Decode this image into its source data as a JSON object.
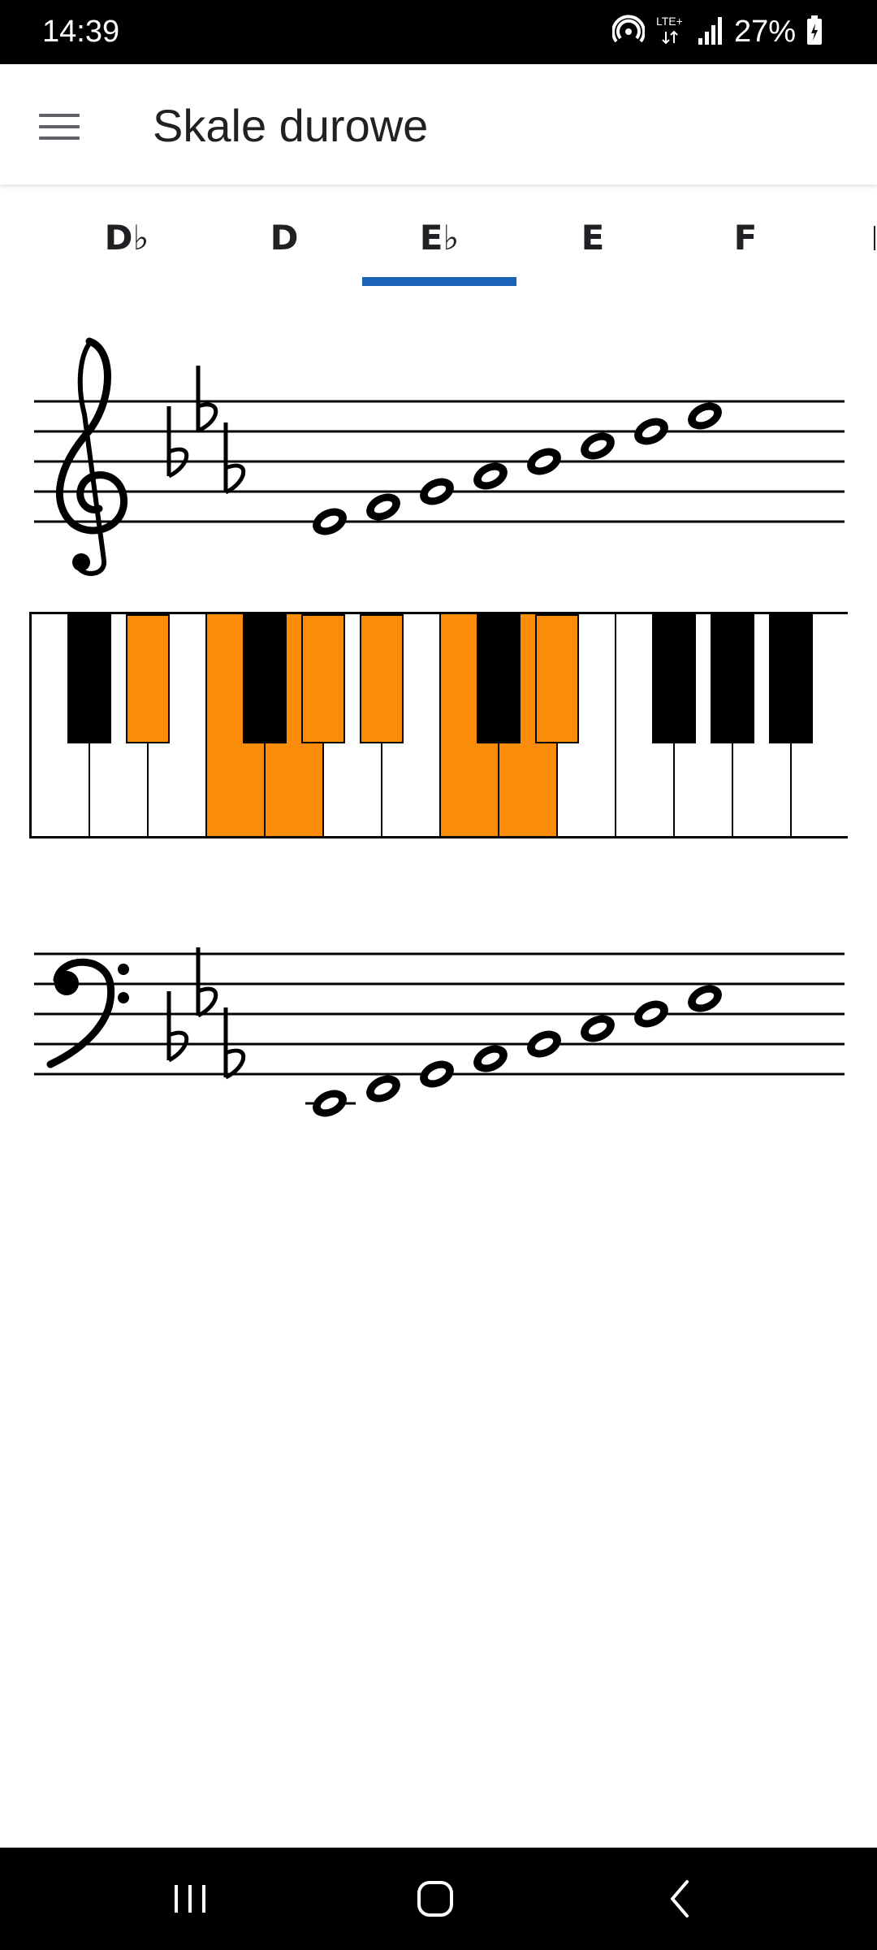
{
  "status_bar": {
    "time": "14:39",
    "network_label": "LTE+",
    "battery_percent": "27%",
    "icons": [
      "hotspot-icon",
      "lte-plus-icon",
      "signal-icon",
      "battery-charging-icon"
    ]
  },
  "app_bar": {
    "title": "Skale durowe",
    "menu_icon": "hamburger-menu-icon"
  },
  "tabs": {
    "items": [
      {
        "label": "D♭",
        "selected": false
      },
      {
        "label": "D",
        "selected": false
      },
      {
        "label": "E♭",
        "selected": true
      },
      {
        "label": "E",
        "selected": false
      },
      {
        "label": "F",
        "selected": false
      }
    ],
    "indicator_color": "#1a63b8"
  },
  "treble_staff": {
    "clef": "treble-clef",
    "key_signature": [
      "B♭",
      "E♭",
      "A♭"
    ],
    "notes": [
      "E♭4",
      "F4",
      "G4",
      "A♭4",
      "B♭4",
      "C5",
      "D5",
      "E♭5"
    ]
  },
  "piano": {
    "white_key_count": 14,
    "highlight_color": "#f98c08",
    "highlighted_white_keys": [
      "F3",
      "G3",
      "C4",
      "D4"
    ],
    "highlighted_black_keys": [
      "E♭3",
      "A♭3",
      "B♭3",
      "E♭4"
    ],
    "highlighted_keys": [
      "E♭3",
      "F3",
      "G3",
      "A♭3",
      "B♭3",
      "C4",
      "D4",
      "E♭4"
    ]
  },
  "bass_staff": {
    "clef": "bass-clef",
    "key_signature": [
      "B♭",
      "E♭",
      "A♭"
    ],
    "notes": [
      "E♭2",
      "F2",
      "G2",
      "A♭2",
      "B♭2",
      "C3",
      "D3",
      "E♭3"
    ]
  },
  "nav_bar": {
    "buttons": [
      "recent-apps-icon",
      "home-icon",
      "back-icon"
    ]
  }
}
